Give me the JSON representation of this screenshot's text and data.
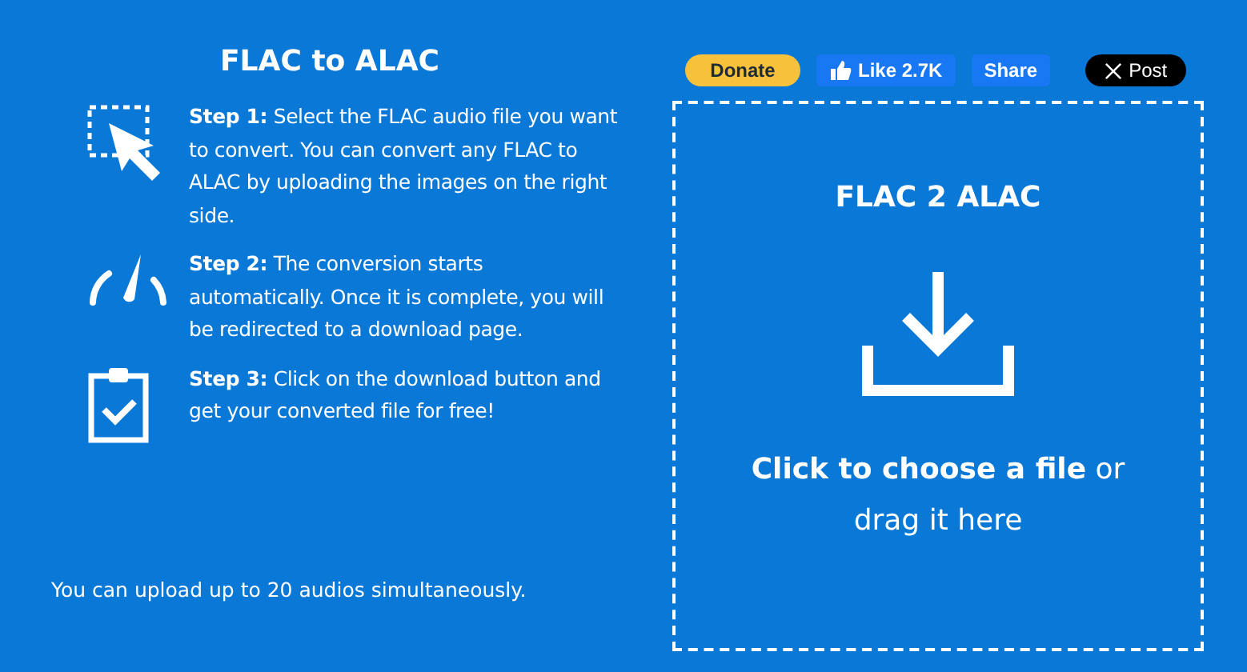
{
  "title": "FLAC to ALAC",
  "steps": [
    {
      "kind": "select",
      "text": "**Step 1:** Select the FLAC audio file you want to convert. You can convert any FLAC to ALAC by uploading the images on the right side."
    },
    {
      "kind": "speed",
      "text": "**Step 2:** The conversion starts automatically. Once it is complete, you will be redirected to a download page."
    },
    {
      "kind": "check",
      "text": "**Step 3:** Click on the download button and get your converted file for free!"
    }
  ],
  "note": "You can upload up to 20 audios simultaneously.",
  "social": {
    "donate": "Donate",
    "like": "Like 2.7K",
    "share": "Share",
    "post": "Post"
  },
  "dropzone": {
    "title": "FLAC 2 ALAC",
    "prompt": "**Click to choose a file** or drag it here"
  }
}
